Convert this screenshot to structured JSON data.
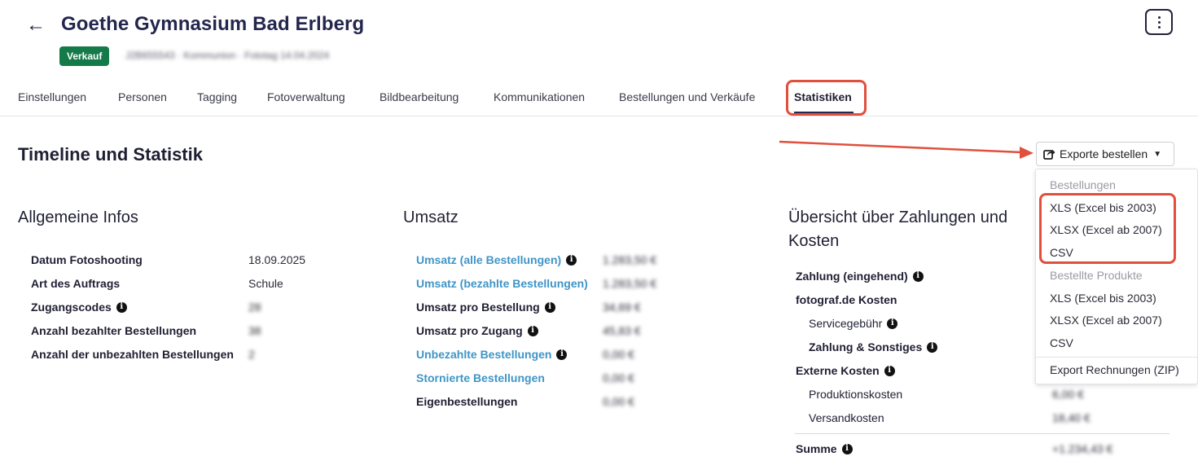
{
  "header": {
    "title": "Goethe Gymnasium Bad Erlberg",
    "badge": "Verkauf",
    "meta_blurred": "J2B655543 · Kommunion · Fototag 14.04.2024"
  },
  "tabs": [
    {
      "label": "Einstellungen"
    },
    {
      "label": "Personen"
    },
    {
      "label": "Tagging"
    },
    {
      "label": "Fotoverwaltung"
    },
    {
      "label": "Bildbearbeitung"
    },
    {
      "label": "Kommunikationen"
    },
    {
      "label": "Bestellungen und Verkäufe"
    },
    {
      "label": "Statistiken"
    }
  ],
  "section_title": "Timeline und Statistik",
  "export": {
    "button_label": "Exporte bestellen",
    "menu": {
      "group1_title": "Bestellungen",
      "group1": [
        "XLS (Excel bis 2003)",
        "XLSX (Excel ab 2007)",
        "CSV"
      ],
      "group2_title": "Bestellte Produkte",
      "group2": [
        "XLS (Excel bis 2003)",
        "XLSX (Excel ab 2007)",
        "CSV"
      ],
      "footer": "Export Rechnungen (ZIP)"
    }
  },
  "general": {
    "title": "Allgemeine Infos",
    "rows": [
      {
        "label": "Datum Fotoshooting",
        "value": "18.09.2025"
      },
      {
        "label": "Art des Auftrags",
        "value": "Schule"
      },
      {
        "label": "Zugangscodes",
        "value": "28"
      },
      {
        "label": "Anzahl bezahlter Bestellungen",
        "value": "38"
      },
      {
        "label": "Anzahl der unbezahlten Bestellungen",
        "value": "2"
      }
    ]
  },
  "revenue": {
    "title": "Umsatz",
    "rows": [
      {
        "label": "Umsatz (alle Bestellungen)",
        "value": "1.283,50 €"
      },
      {
        "label": "Umsatz (bezahlte Bestellungen)",
        "value": "1.283,50 €"
      },
      {
        "label": "Umsatz pro Bestellung",
        "value": "34,69 €"
      },
      {
        "label": "Umsatz pro Zugang",
        "value": "45,83 €"
      },
      {
        "label": "Unbezahlte Bestellungen",
        "value": "0,00 €"
      },
      {
        "label": "Stornierte Bestellungen",
        "value": "0,00 €"
      },
      {
        "label": "Eigenbestellungen",
        "value": "0,00 €"
      }
    ]
  },
  "payments": {
    "title_line1": "Übersicht über Zahlungen und",
    "title_line2": "Kosten",
    "rows": [
      {
        "label": "Zahlung (eingehend)",
        "value": ""
      },
      {
        "label": "fotograf.de Kosten",
        "value": ""
      },
      {
        "label": "Servicegebühr",
        "value": ""
      },
      {
        "label": "Zahlung & Sonstiges",
        "value": ""
      },
      {
        "label": "Externe Kosten",
        "value": ""
      },
      {
        "label": "Produktionskosten",
        "value": "6,00 €"
      },
      {
        "label": "Versandkosten",
        "value": "18,40 €"
      }
    ],
    "sum_label": "Summe",
    "sum_value": "+1.234,43 €"
  },
  "colors": {
    "accent_dark": "#23264d",
    "badge_green": "#157a4a",
    "link_blue": "#3f95c6",
    "highlight_red": "#e0503d"
  }
}
